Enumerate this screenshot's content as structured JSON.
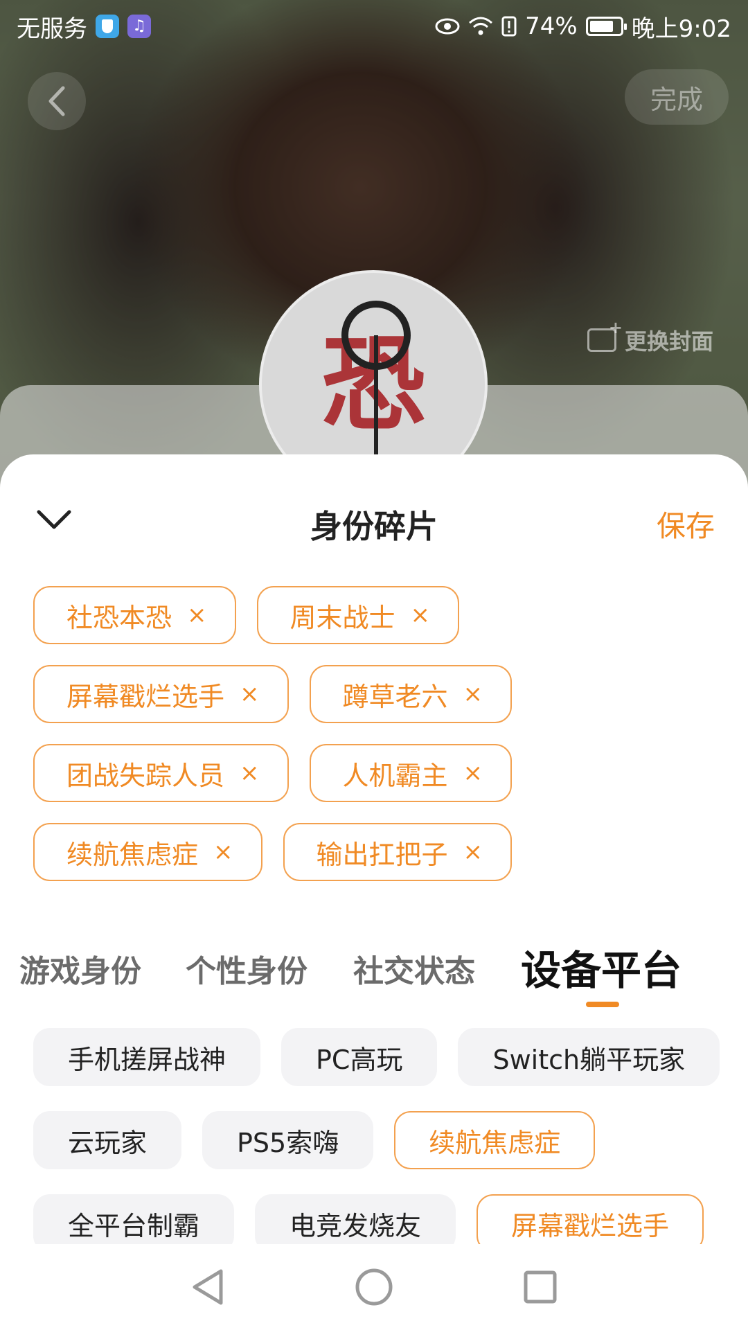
{
  "status_bar": {
    "carrier": "无服务",
    "battery_pct": "74%",
    "time": "晚上9:02"
  },
  "top_nav": {
    "done_label": "完成",
    "change_cover_label": "更换封面"
  },
  "sheet": {
    "title": "身份碎片",
    "save_label": "保存",
    "selected_tags": [
      [
        "社恐本恐",
        "周末战士"
      ],
      [
        "屏幕戳烂选手",
        "蹲草老六"
      ],
      [
        "团战失踪人员",
        "人机霸主"
      ],
      [
        "续航焦虑症",
        "输出扛把子"
      ]
    ],
    "remove_glyph": "×",
    "categories": [
      "游戏身份",
      "个性身份",
      "社交状态",
      "设备平台"
    ],
    "active_category": "设备平台",
    "options": [
      [
        {
          "label": "手机搓屏战神",
          "selected": false
        },
        {
          "label": "PC高玩",
          "selected": false
        },
        {
          "label": "Switch躺平玩家",
          "selected": false
        }
      ],
      [
        {
          "label": "云玩家",
          "selected": false
        },
        {
          "label": "PS5索嗨",
          "selected": false
        },
        {
          "label": "续航焦虑症",
          "selected": true
        }
      ],
      [
        {
          "label": "全平台制霸",
          "selected": false
        },
        {
          "label": "电竞发烧友",
          "selected": false
        },
        {
          "label": "屏幕戳烂选手",
          "selected": true
        }
      ]
    ]
  },
  "colors": {
    "accent": "#f08a24",
    "tag_border": "#f3a14f",
    "option_bg": "#f3f3f5"
  }
}
